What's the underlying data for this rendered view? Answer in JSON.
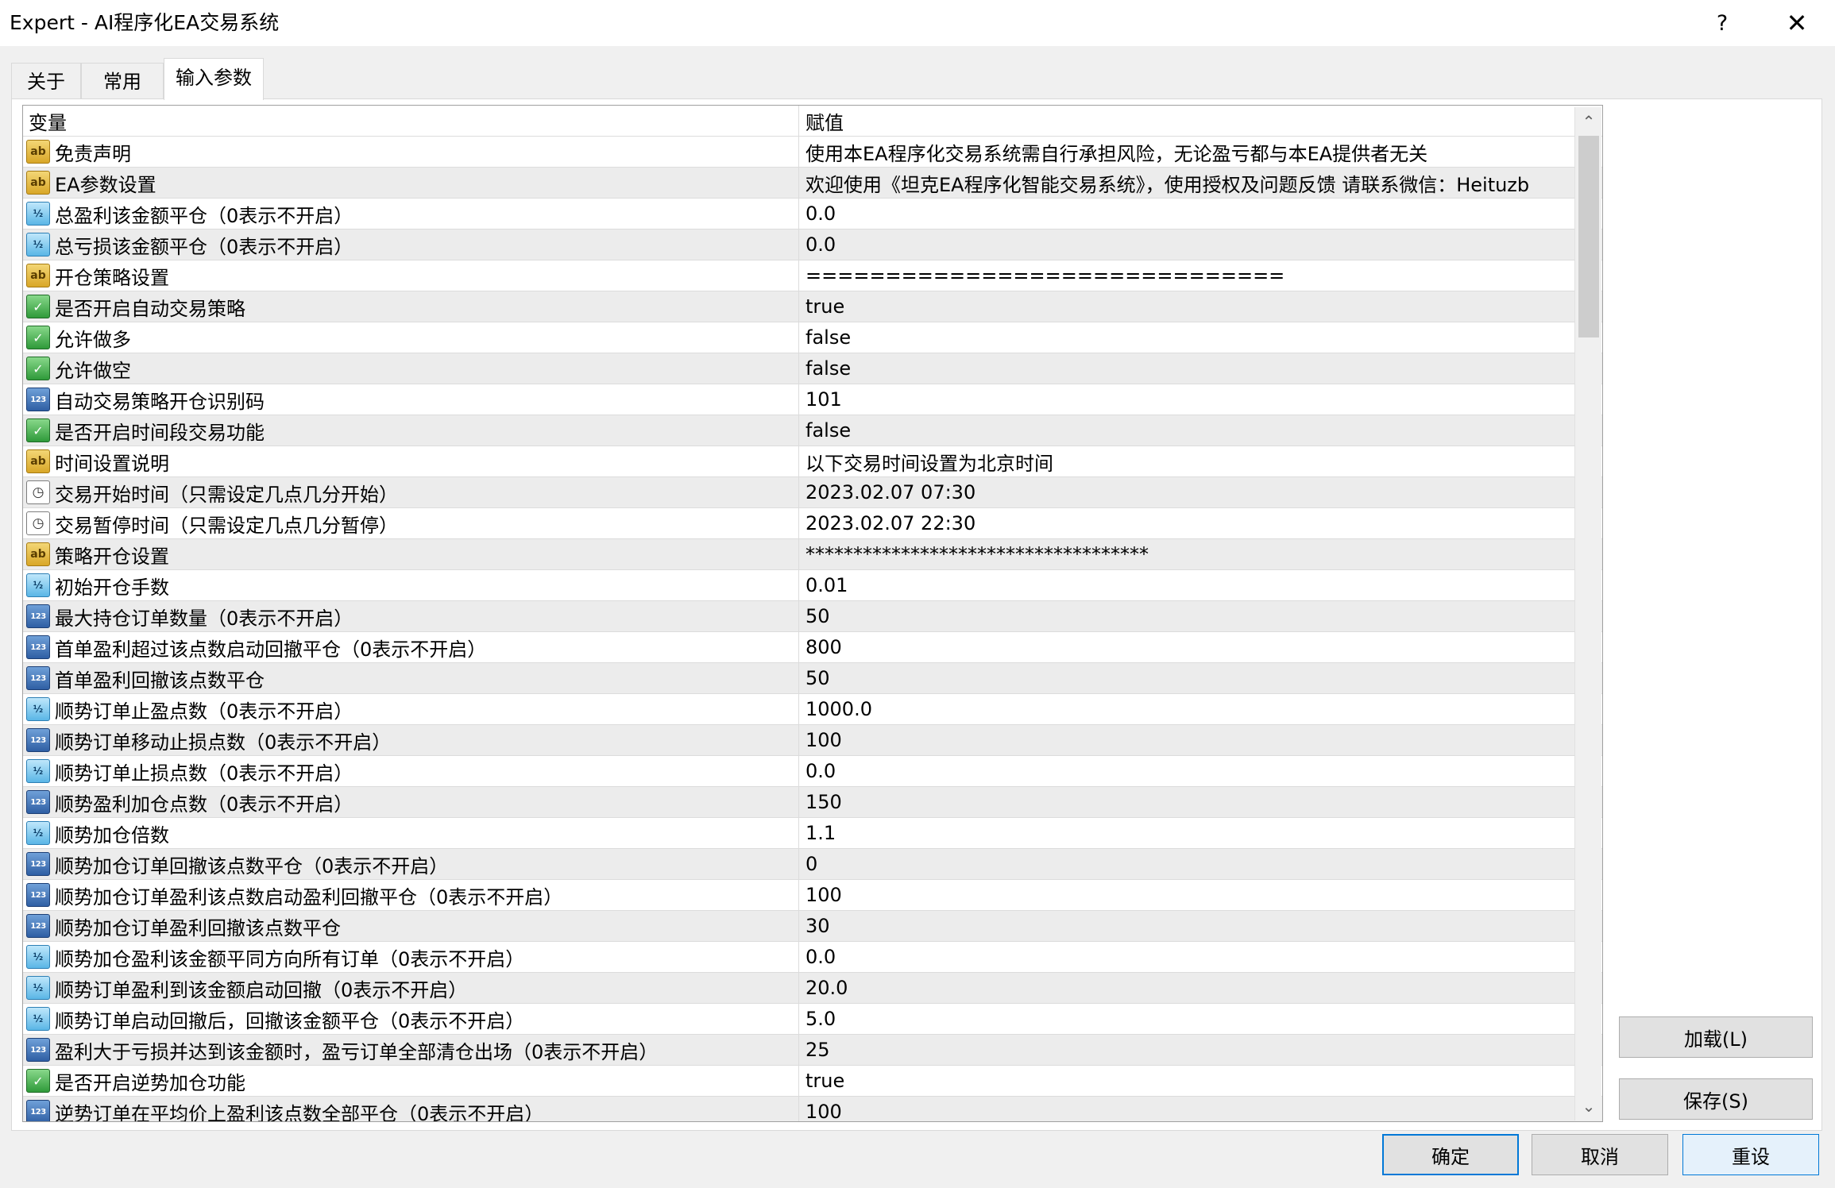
{
  "window": {
    "title": "Expert - AI程序化EA交易系统",
    "help_label": "?",
    "close_label": "✕"
  },
  "tabs": [
    {
      "label": "关于"
    },
    {
      "label": "常用"
    },
    {
      "label": "输入参数"
    }
  ],
  "grid": {
    "headers": {
      "variable": "变量",
      "value": "赋值"
    },
    "rows": [
      {
        "type": "ab",
        "name": "免责声明",
        "value": "使用本EA程序化交易系统需自行承担风险，无论盈亏都与本EA提供者无关"
      },
      {
        "type": "ab",
        "name": "EA参数设置",
        "value": "欢迎使用《坦克EA程序化智能交易系统》，使用授权及问题反馈 请联系微信：Heituzb"
      },
      {
        "type": "v2",
        "name": "总盈利该金额平仓（0表示不开启）",
        "value": "0.0"
      },
      {
        "type": "v2",
        "name": "总亏损该金额平仓（0表示不开启）",
        "value": "0.0"
      },
      {
        "type": "ab",
        "name": "开仓策略设置",
        "value": "=============================="
      },
      {
        "type": "bool",
        "name": "是否开启自动交易策略",
        "value": "true"
      },
      {
        "type": "bool",
        "name": "允许做多",
        "value": "false"
      },
      {
        "type": "bool",
        "name": "允许做空",
        "value": "false"
      },
      {
        "type": "123",
        "name": "自动交易策略开仓识别码",
        "value": "101"
      },
      {
        "type": "bool",
        "name": "是否开启时间段交易功能",
        "value": "false"
      },
      {
        "type": "ab",
        "name": "时间设置说明",
        "value": "以下交易时间设置为北京时间"
      },
      {
        "type": "time",
        "name": "交易开始时间（只需设定几点几分开始）",
        "value": "2023.02.07 07:30"
      },
      {
        "type": "time",
        "name": "交易暂停时间（只需设定几点几分暂停）",
        "value": "2023.02.07 22:30"
      },
      {
        "type": "ab",
        "name": "策略开仓设置",
        "value": "************************************"
      },
      {
        "type": "v2",
        "name": "初始开仓手数",
        "value": "0.01"
      },
      {
        "type": "123",
        "name": "最大持仓订单数量（0表示不开启）",
        "value": "50"
      },
      {
        "type": "123",
        "name": "首单盈利超过该点数启动回撤平仓（0表示不开启）",
        "value": "800"
      },
      {
        "type": "123",
        "name": "首单盈利回撤该点数平仓",
        "value": "50"
      },
      {
        "type": "v2",
        "name": "顺势订单止盈点数（0表示不开启）",
        "value": "1000.0"
      },
      {
        "type": "123",
        "name": "顺势订单移动止损点数（0表示不开启）",
        "value": "100"
      },
      {
        "type": "v2",
        "name": "顺势订单止损点数（0表示不开启）",
        "value": "0.0"
      },
      {
        "type": "123",
        "name": "顺势盈利加仓点数（0表示不开启）",
        "value": "150"
      },
      {
        "type": "v2",
        "name": "顺势加仓倍数",
        "value": "1.1"
      },
      {
        "type": "123",
        "name": "顺势加仓订单回撤该点数平仓（0表示不开启）",
        "value": "0"
      },
      {
        "type": "123",
        "name": "顺势加仓订单盈利该点数启动盈利回撤平仓（0表示不开启）",
        "value": "100"
      },
      {
        "type": "123",
        "name": "顺势加仓订单盈利回撤该点数平仓",
        "value": "30"
      },
      {
        "type": "v2",
        "name": "顺势加仓盈利该金额平同方向所有订单（0表示不开启）",
        "value": "0.0"
      },
      {
        "type": "v2",
        "name": "顺势订单盈利到该金额启动回撤（0表示不开启）",
        "value": "20.0"
      },
      {
        "type": "v2",
        "name": "顺势订单启动回撤后，回撤该金额平仓（0表示不开启）",
        "value": "5.0"
      },
      {
        "type": "123",
        "name": "盈利大于亏损并达到该金额时，盈亏订单全部清仓出场（0表示不开启）",
        "value": "25"
      },
      {
        "type": "bool",
        "name": "是否开启逆势加仓功能",
        "value": "true"
      },
      {
        "type": "123",
        "name": "逆势订单在平均价上盈利该点数全部平仓（0表示不开启）",
        "value": "100"
      }
    ]
  },
  "icons": {
    "ab": "ab",
    "v2": "½",
    "123": "123",
    "bool": "✓",
    "time": "◷"
  },
  "scrollbar": {
    "up": "⌃",
    "down": "⌄"
  },
  "side_buttons": {
    "load": "加载(L)",
    "save": "保存(S)"
  },
  "footer_buttons": {
    "ok": "确定",
    "cancel": "取消",
    "reset": "重设"
  }
}
